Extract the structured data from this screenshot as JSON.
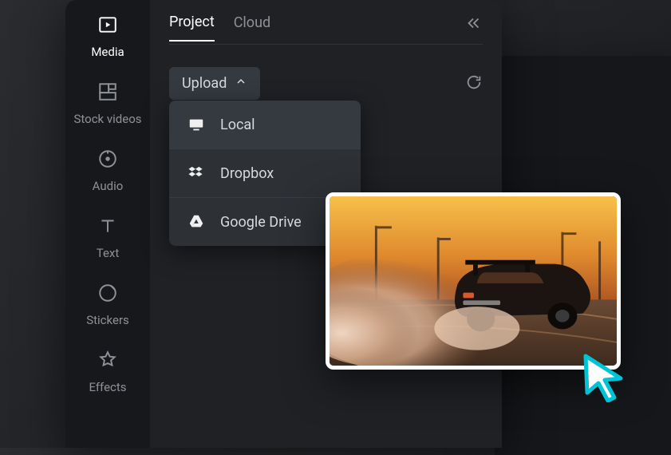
{
  "sidebar": {
    "items": [
      {
        "key": "media",
        "label": "Media"
      },
      {
        "key": "stockvideos",
        "label": "Stock videos"
      },
      {
        "key": "audio",
        "label": "Audio"
      },
      {
        "key": "text",
        "label": "Text"
      },
      {
        "key": "stickers",
        "label": "Stickers"
      },
      {
        "key": "effects",
        "label": "Effects"
      }
    ],
    "active": "media"
  },
  "tabs": {
    "items": [
      {
        "key": "project",
        "label": "Project"
      },
      {
        "key": "cloud",
        "label": "Cloud"
      }
    ],
    "active": "project"
  },
  "toolbar": {
    "upload_label": "Upload"
  },
  "upload_menu": {
    "items": [
      {
        "key": "local",
        "label": "Local"
      },
      {
        "key": "dropbox",
        "label": "Dropbox"
      },
      {
        "key": "googledrive",
        "label": "Google Drive"
      }
    ],
    "hovered": "local"
  },
  "preview": {
    "description": "car-drifting-sunset"
  }
}
